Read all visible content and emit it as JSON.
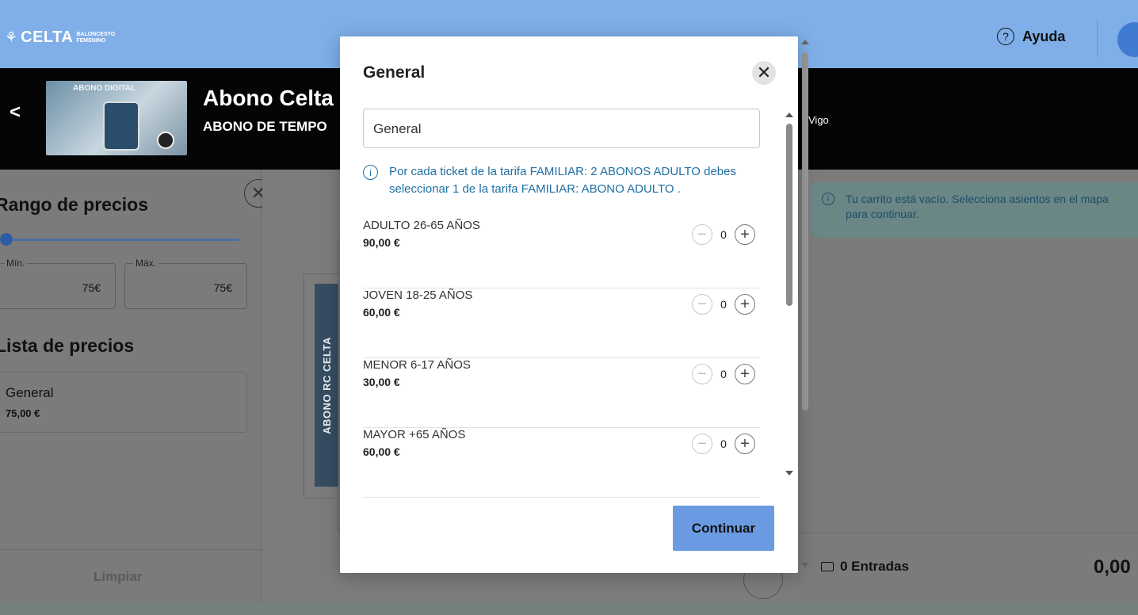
{
  "header": {
    "logo_text": "CELTA",
    "logo_sub_1": "BALONCESTO",
    "logo_sub_2": "FEMENINO",
    "help_label": "Ayuda"
  },
  "event": {
    "thumbnail_label": "ABONO DIGITAL",
    "title": "Abono Celta",
    "subtitle": "ABONO DE TEMPO",
    "venue_fragment": "Vigo"
  },
  "filters": {
    "price_range_title": "Rango de precios",
    "min_label": "Mín.",
    "min_value": "75€",
    "max_label": "Máx.",
    "max_value": "75€",
    "price_list_title": "Lista de precios",
    "price_items": [
      {
        "name": "General",
        "price": "75,00 €"
      }
    ],
    "clear_label": "Limpiar"
  },
  "map": {
    "block_label": "ABONO RC CELTA"
  },
  "cart": {
    "empty_message": "Tu carrito está vacío. Selecciona asientos en el mapa para continuar.",
    "count_label": "0 Entradas",
    "total": "0,00"
  },
  "modal": {
    "title": "General",
    "select_value": "General",
    "info_text": "Por cada ticket de la tarifa FAMILIAR: 2 ABONOS ADULTO debes seleccionar 1 de la tarifa FAMILIAR: ABONO ADULTO .",
    "rates": [
      {
        "name": "ADULTO 26-65 AÑOS",
        "price": "90,00 €",
        "quantity": "0"
      },
      {
        "name": "JOVEN 18-25 AÑOS",
        "price": "60,00 €",
        "quantity": "0"
      },
      {
        "name": "MENOR 6-17 AÑOS",
        "price": "30,00 €",
        "quantity": "0"
      },
      {
        "name": "MAYOR +65 AÑOS",
        "price": "60,00 €",
        "quantity": "0"
      }
    ],
    "continue_label": "Continuar"
  },
  "icons": {
    "close": "close-icon",
    "info": "info-icon",
    "minus": "minus-icon",
    "plus": "plus-icon",
    "help": "help-icon",
    "ticket": "ticket-icon",
    "back": "chevron-left-icon"
  },
  "colors": {
    "accent": "#6a9be2",
    "info_text": "#1f6fa3",
    "topbar": "#7faee8"
  }
}
